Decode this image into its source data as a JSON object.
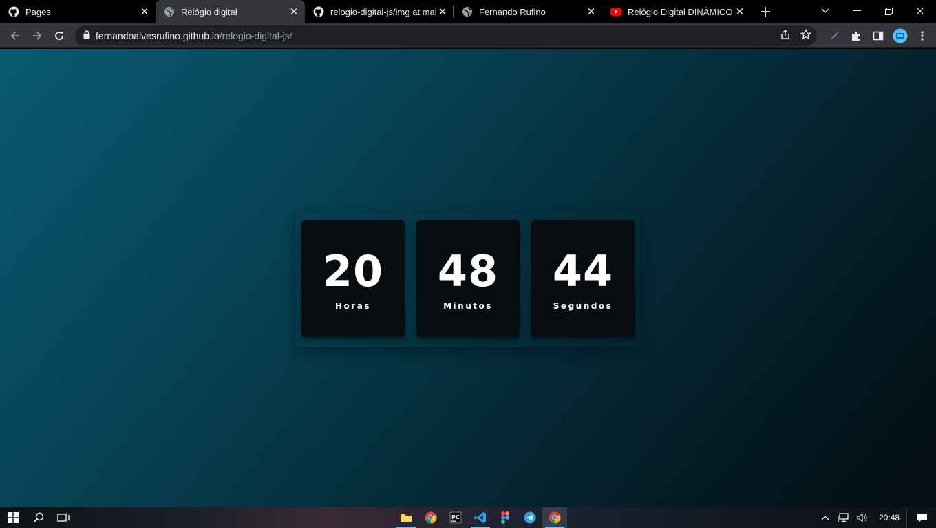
{
  "browser": {
    "tabs": [
      {
        "title": "Pages",
        "favicon": "github-icon",
        "active": false
      },
      {
        "title": "Relógio digital",
        "favicon": "globe-icon",
        "active": true
      },
      {
        "title": "relogio-digital-js/img at mai",
        "favicon": "github-icon",
        "active": false
      },
      {
        "title": "Fernando Rufino",
        "favicon": "globe-icon",
        "active": false
      },
      {
        "title": "Relógio Digital DINÂMICO | H",
        "favicon": "youtube-icon",
        "active": false
      }
    ],
    "url": {
      "host": "fernandoalvesrufino.github.io",
      "path": "/relogio-digital-js/"
    }
  },
  "clock": {
    "hours": {
      "value": "20",
      "label": "Horas"
    },
    "minutes": {
      "value": "48",
      "label": "Minutos"
    },
    "seconds": {
      "value": "44",
      "label": "Segundos"
    }
  },
  "taskbar": {
    "time": "20:48"
  },
  "colors": {
    "page_gradient_start": "#0a5b72",
    "page_gradient_end": "#040d12",
    "card_bg": "#080c10",
    "tab_active": "#35363a"
  }
}
